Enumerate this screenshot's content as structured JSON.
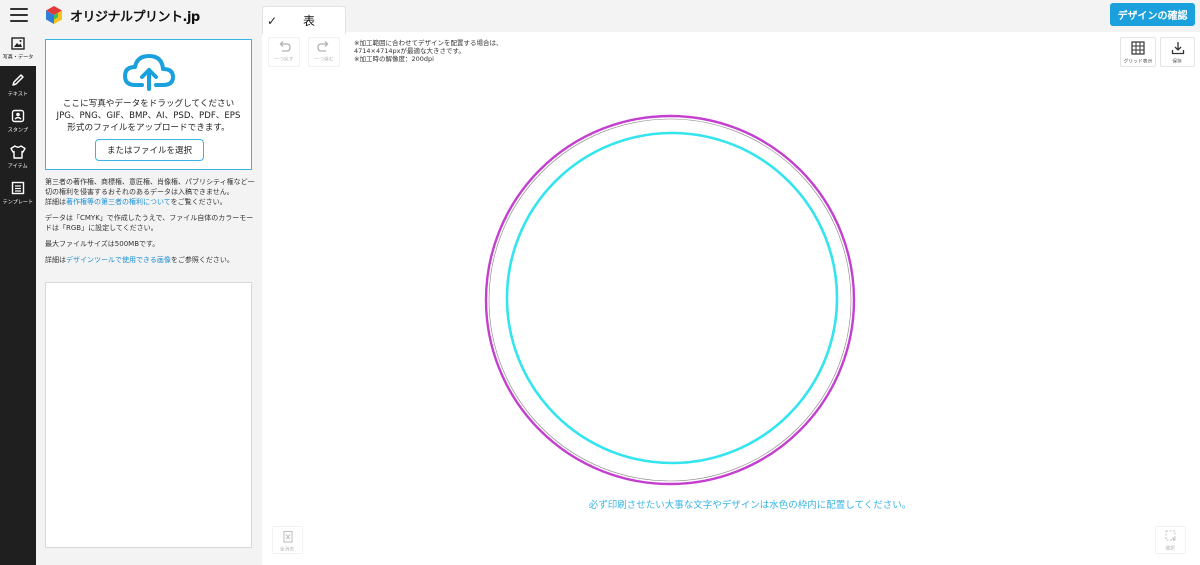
{
  "header": {
    "brand_text": "オリジナルプリント.jp",
    "side_tab_label": "表",
    "confirm_label": "デザインの確認"
  },
  "rail": {
    "items": [
      {
        "label": "写真・データ",
        "icon": "image-icon"
      },
      {
        "label": "テキスト",
        "icon": "pencil-icon"
      },
      {
        "label": "スタンプ",
        "icon": "stamp-icon"
      },
      {
        "label": "アイテム",
        "icon": "tshirt-icon"
      },
      {
        "label": "テンプレート",
        "icon": "list-icon"
      }
    ]
  },
  "upload": {
    "drop_line1": "ここに写真やデータをドラッグしてください",
    "drop_line2": "JPG、PNG、GIF、BMP、AI、PSD、PDF、EPS",
    "drop_line3": "形式のファイルをアップロードできます。",
    "choose_label": "またはファイルを選択",
    "note_rights": "第三者の著作権、商標権、意匠権、肖像権、パブリシティ権など一切の権利を侵害するおそれのあるデータは入稿できません。",
    "note_detail_prefix": "詳細は",
    "note_detail_link": "著作権等の第三者の権利について",
    "note_detail_suffix": "をご覧ください。",
    "note_cmyk": "データは「CMYK」で作成したうえで、ファイル自体のカラーモードは「RGB」に設定してください。",
    "note_maxsize": "最大ファイルサイズは500MBです。",
    "note_images_prefix": "詳細は",
    "note_images_link": "デザインツールで使用できる画像",
    "note_images_suffix": "をご参照ください。"
  },
  "toolbar": {
    "undo_label": "一つ戻す",
    "redo_label": "一つ進む",
    "grid_label": "グリッド表示",
    "save_label": "保存",
    "delete_all_label": "全消去",
    "select_label": "選択"
  },
  "info": {
    "line1": "※加工範囲に合わせてデザインを配置する場合は、",
    "line2": "4714×4714pxが最適な大きさです。",
    "line3": "※加工時の解像度：200dpi"
  },
  "canvas": {
    "warning": "必ず印刷させたい大事な文字やデザインは水色の枠内に配置してください。",
    "outer_ring_color": "#c43fd0",
    "inner_ring_color": "#34e4ee"
  },
  "colors": {
    "accent": "#1aa1dd",
    "link": "#1a8fd6",
    "rail_bg": "#1f1f1f"
  }
}
